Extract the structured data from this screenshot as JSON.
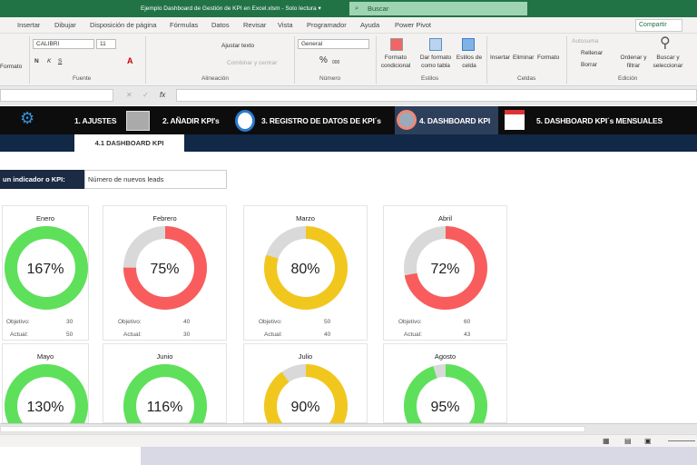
{
  "window": {
    "title": "Ejemplo Dashboard de Gestión de KPI en Excel.xlsm  -  Solo lectura  ▾",
    "search": "Buscar"
  },
  "tabs": [
    "Insertar",
    "Dibujar",
    "Disposición de página",
    "Fórmulas",
    "Datos",
    "Revisar",
    "Vista",
    "Programador",
    "Ayuda",
    "Power Pivot"
  ],
  "share": "Compartir",
  "ribbon": {
    "font_name": "CALIBRI",
    "font_size": "11",
    "bold": "N",
    "italic": "K",
    "underline": "S",
    "wrap": "Ajustar texto",
    "merge": "Combinar y centrar",
    "number_format": "General",
    "percent": "%",
    "thousands": "000",
    "format_left": "Formato",
    "cond_format": "Formato condicional",
    "table_format": "Dar formato como tabla",
    "cell_styles": "Estilos de celda",
    "insert": "Insertar",
    "delete": "Eliminar",
    "format": "Formato",
    "autosum": "Autosuma",
    "fill": "Rellenar",
    "clear": "Borrar",
    "sort": "Ordenar y filtrar",
    "find": "Buscar y seleccionar",
    "groups": [
      "Fuente",
      "Alineación",
      "Número",
      "Estilos",
      "Celdas",
      "Edición"
    ]
  },
  "formula_bar": {
    "fx": "fx",
    "cancel": "✕",
    "enter": "✓"
  },
  "nav": {
    "items": [
      "1. AJUSTES",
      "2. AÑADIR KPI's",
      "3. REGISTRO DE DATOS DE KPI´s",
      "4. DASHBOARD KPI",
      "5. DASHBOARD KPI´s MENSUALES"
    ],
    "subtab": "4.1 DASHBOARD KPI"
  },
  "kpi": {
    "label": "un indicador o KPI:",
    "value": "Número de nuevos leads"
  },
  "labels": {
    "objetivo": "Objetivo:",
    "actual": "Actual:"
  },
  "colors": {
    "green": "#5ee05a",
    "red": "#f95c5c",
    "yellow": "#f2c71d",
    "gray": "#d9d9d9"
  },
  "months": [
    {
      "name": "Enero",
      "pct": "167%",
      "value": 1.67,
      "color": "#5ee05a",
      "objetivo": "30",
      "actual": "50"
    },
    {
      "name": "Febrero",
      "pct": "75%",
      "value": 0.75,
      "color": "#f95c5c",
      "objetivo": "40",
      "actual": "30"
    },
    {
      "name": "Marzo",
      "pct": "80%",
      "value": 0.8,
      "color": "#f2c71d",
      "objetivo": "50",
      "actual": "40"
    },
    {
      "name": "Abril",
      "pct": "72%",
      "value": 0.72,
      "color": "#f95c5c",
      "objetivo": "60",
      "actual": "43"
    },
    {
      "name": "Mayo",
      "pct": "130%",
      "value": 1.3,
      "color": "#5ee05a"
    },
    {
      "name": "Junio",
      "pct": "116%",
      "value": 1.16,
      "color": "#5ee05a"
    },
    {
      "name": "Julio",
      "pct": "90%",
      "value": 0.9,
      "color": "#f2c71d"
    },
    {
      "name": "Agosto",
      "pct": "95%",
      "value": 0.95,
      "color": "#5ee05a"
    }
  ]
}
